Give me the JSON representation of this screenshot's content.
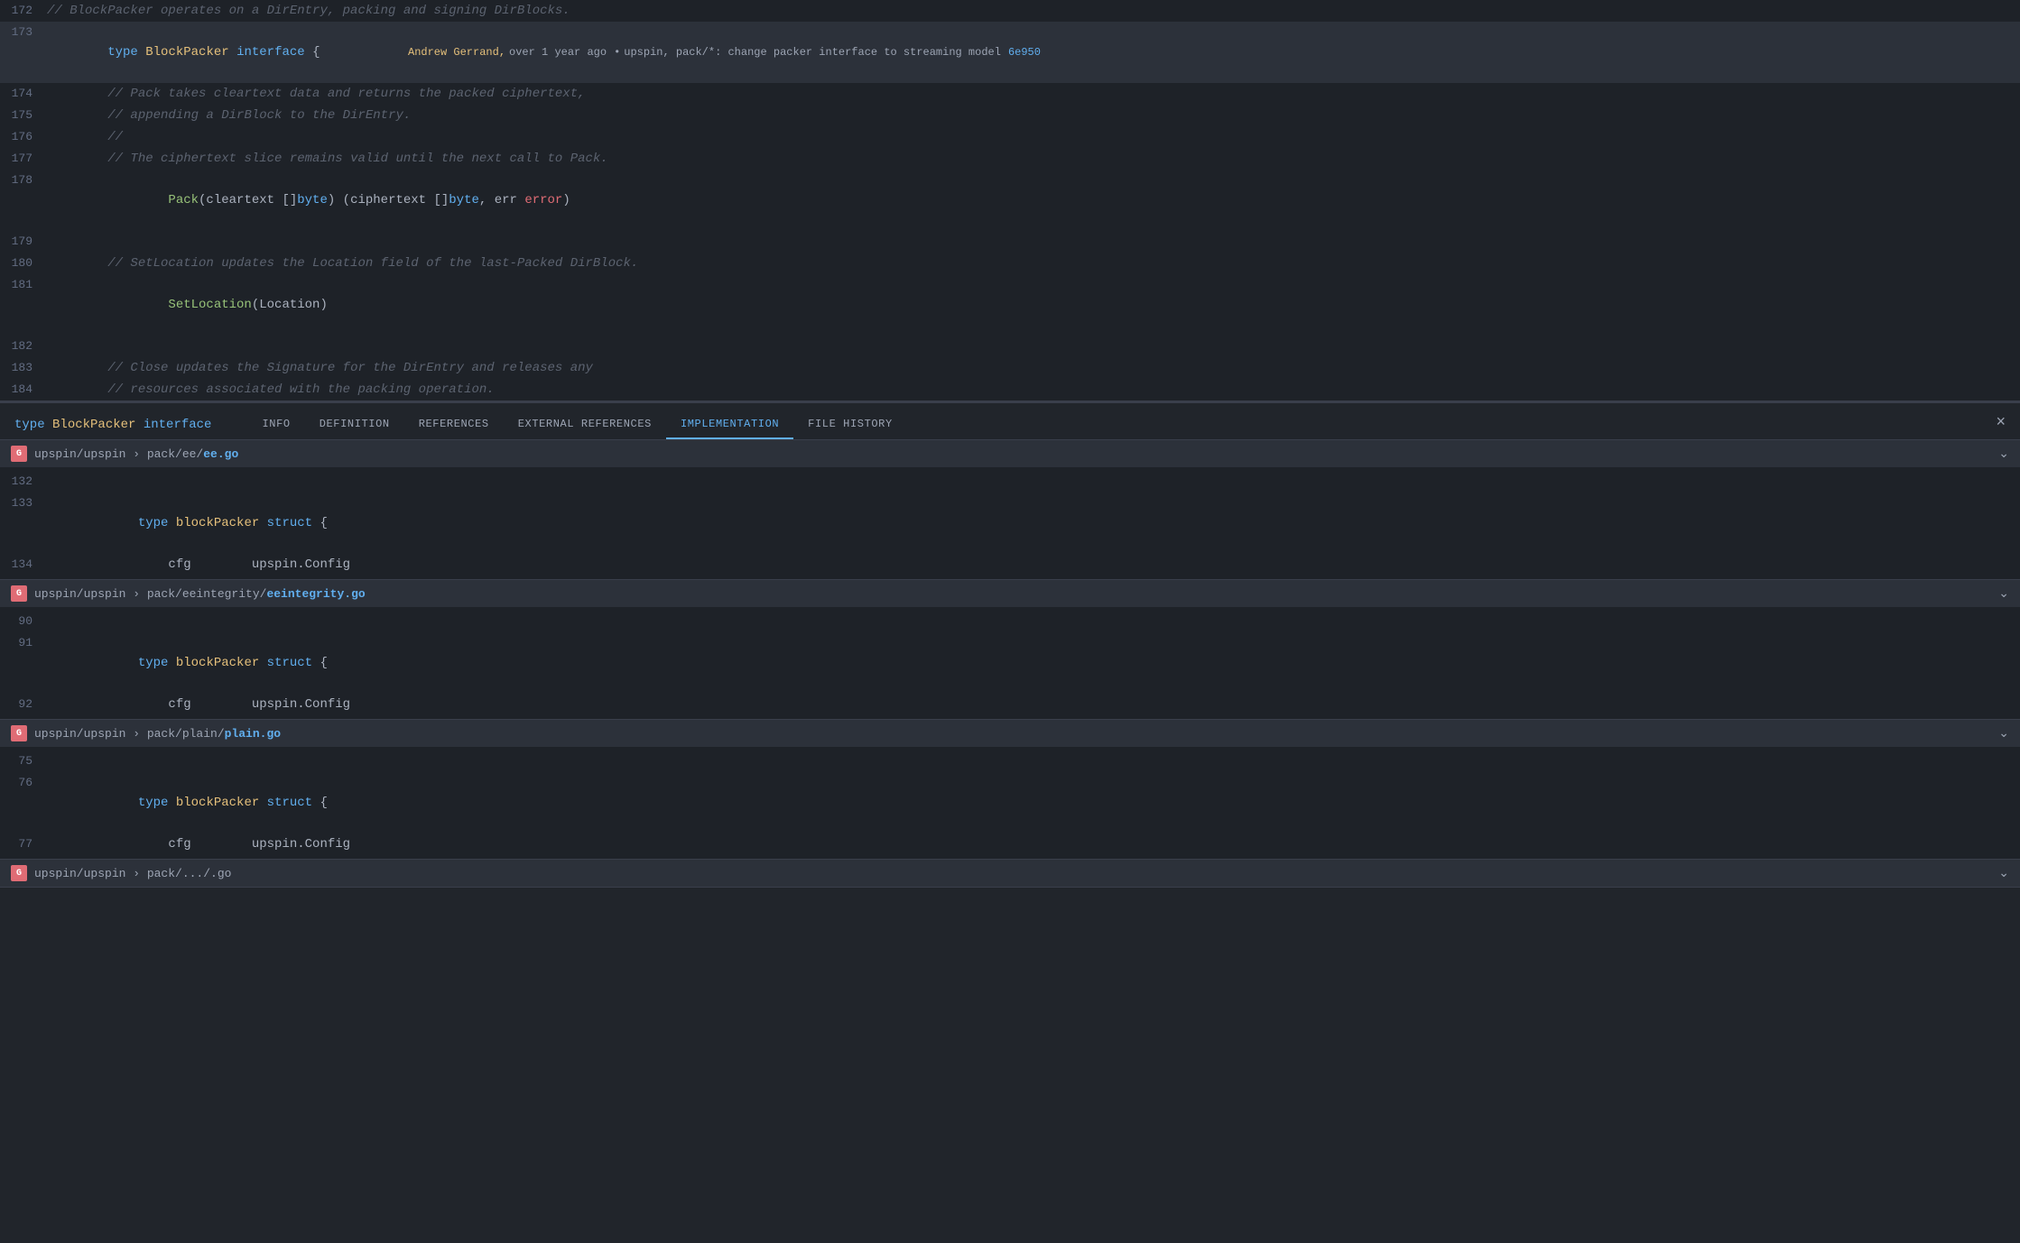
{
  "blame": {
    "author": "Andrew Gerrand,",
    "time": "over 1 year ago",
    "dot": "•",
    "message": "upspin, pack/*: change packer interface to streaming model",
    "hash": "6e950"
  },
  "code_lines": [
    {
      "num": "172",
      "content": "// BlockPacker operates on a DirEntry, packing and signing DirBlocks.",
      "type": "comment"
    },
    {
      "num": "173",
      "content_parts": [
        {
          "text": "type ",
          "class": "kw-type"
        },
        {
          "text": "BlockPacker ",
          "class": "name-block-packer"
        },
        {
          "text": "interface",
          "class": "kw-interface"
        },
        {
          "text": " {",
          "class": "punct"
        }
      ],
      "highlight": true
    },
    {
      "num": "174",
      "content": "\t// Pack takes cleartext data and returns the packed ciphertext,",
      "type": "comment"
    },
    {
      "num": "175",
      "content": "\t// appending a DirBlock to the DirEntry.",
      "type": "comment"
    },
    {
      "num": "176",
      "content": "\t//",
      "type": "comment"
    },
    {
      "num": "177",
      "content": "\t// The ciphertext slice remains valid until the next call to Pack.",
      "type": "comment"
    },
    {
      "num": "178",
      "content_parts": [
        {
          "text": "\t",
          "class": "plain"
        },
        {
          "text": "Pack",
          "class": "fn-name"
        },
        {
          "text": "(cleartext []",
          "class": "plain"
        },
        {
          "text": "byte",
          "class": "type-byte"
        },
        {
          "text": ") (ciphertext []",
          "class": "plain"
        },
        {
          "text": "byte",
          "class": "type-byte"
        },
        {
          "text": ", err ",
          "class": "plain"
        },
        {
          "text": "error",
          "class": "type-error"
        },
        {
          "text": ")",
          "class": "plain"
        }
      ]
    },
    {
      "num": "179",
      "content": "",
      "type": "plain"
    },
    {
      "num": "180",
      "content": "\t// SetLocation updates the Location field of the last-Packed DirBlock.",
      "type": "comment"
    },
    {
      "num": "181",
      "content_parts": [
        {
          "text": "\t",
          "class": "plain"
        },
        {
          "text": "SetLocation",
          "class": "fn-name"
        },
        {
          "text": "(Location)",
          "class": "plain"
        }
      ]
    },
    {
      "num": "182",
      "content": "",
      "type": "plain"
    },
    {
      "num": "183",
      "content": "\t// Close updates the Signature for the DirEntry and releases any",
      "type": "comment"
    },
    {
      "num": "184",
      "content": "\t// resources associated with the packing operation.",
      "type": "comment"
    }
  ],
  "panel": {
    "title_type": "type",
    "title_name": "BlockPacker",
    "title_interface": "interface",
    "close_label": "×",
    "tabs": [
      {
        "id": "info",
        "label": "INFO"
      },
      {
        "id": "definition",
        "label": "DEFINITION"
      },
      {
        "id": "references",
        "label": "REFERENCES"
      },
      {
        "id": "external-references",
        "label": "EXTERNAL REFERENCES"
      },
      {
        "id": "implementation",
        "label": "IMPLEMENTATION",
        "active": true
      },
      {
        "id": "file-history",
        "label": "FILE HISTORY"
      }
    ]
  },
  "implementations": [
    {
      "id": "ee",
      "path_prefix": "upspin/upspin › pack/ee/",
      "file_name": "ee.go",
      "icon_label": "G",
      "lines": [
        {
          "num": "132",
          "content": "",
          "type": "plain"
        },
        {
          "num": "133",
          "content_parts": [
            {
              "text": "type ",
              "class": "kw-type"
            },
            {
              "text": "blockPacker ",
              "class": "name-block-packer-lower"
            },
            {
              "text": "struct",
              "class": "kw-struct"
            },
            {
              "text": " {",
              "class": "punct"
            }
          ]
        },
        {
          "num": "134",
          "content_parts": [
            {
              "text": "\t\tcfg\t   upspin.Config",
              "class": "plain"
            }
          ]
        }
      ]
    },
    {
      "id": "eeintegrity",
      "path_prefix": "upspin/upspin › pack/eeintegrity/",
      "file_name": "eeintegrity.go",
      "icon_label": "G",
      "lines": [
        {
          "num": "90",
          "content": "",
          "type": "plain"
        },
        {
          "num": "91",
          "content_parts": [
            {
              "text": "type ",
              "class": "kw-type"
            },
            {
              "text": "blockPacker ",
              "class": "name-block-packer-lower"
            },
            {
              "text": "struct",
              "class": "kw-struct"
            },
            {
              "text": " {",
              "class": "punct"
            }
          ]
        },
        {
          "num": "92",
          "content_parts": [
            {
              "text": "\t\tcfg\t   upspin.Config",
              "class": "plain"
            }
          ]
        }
      ]
    },
    {
      "id": "plain",
      "path_prefix": "upspin/upspin › pack/plain/",
      "file_name": "plain.go",
      "icon_label": "G",
      "lines": [
        {
          "num": "75",
          "content": "",
          "type": "plain"
        },
        {
          "num": "76",
          "content_parts": [
            {
              "text": "type ",
              "class": "kw-type"
            },
            {
              "text": "blockPacker ",
              "class": "name-block-packer-lower"
            },
            {
              "text": "struct",
              "class": "kw-struct"
            },
            {
              "text": " {",
              "class": "punct"
            }
          ]
        },
        {
          "num": "77",
          "content_parts": [
            {
              "text": "\t\tcfg\t   upspin.Config",
              "class": "plain"
            }
          ]
        }
      ]
    }
  ]
}
